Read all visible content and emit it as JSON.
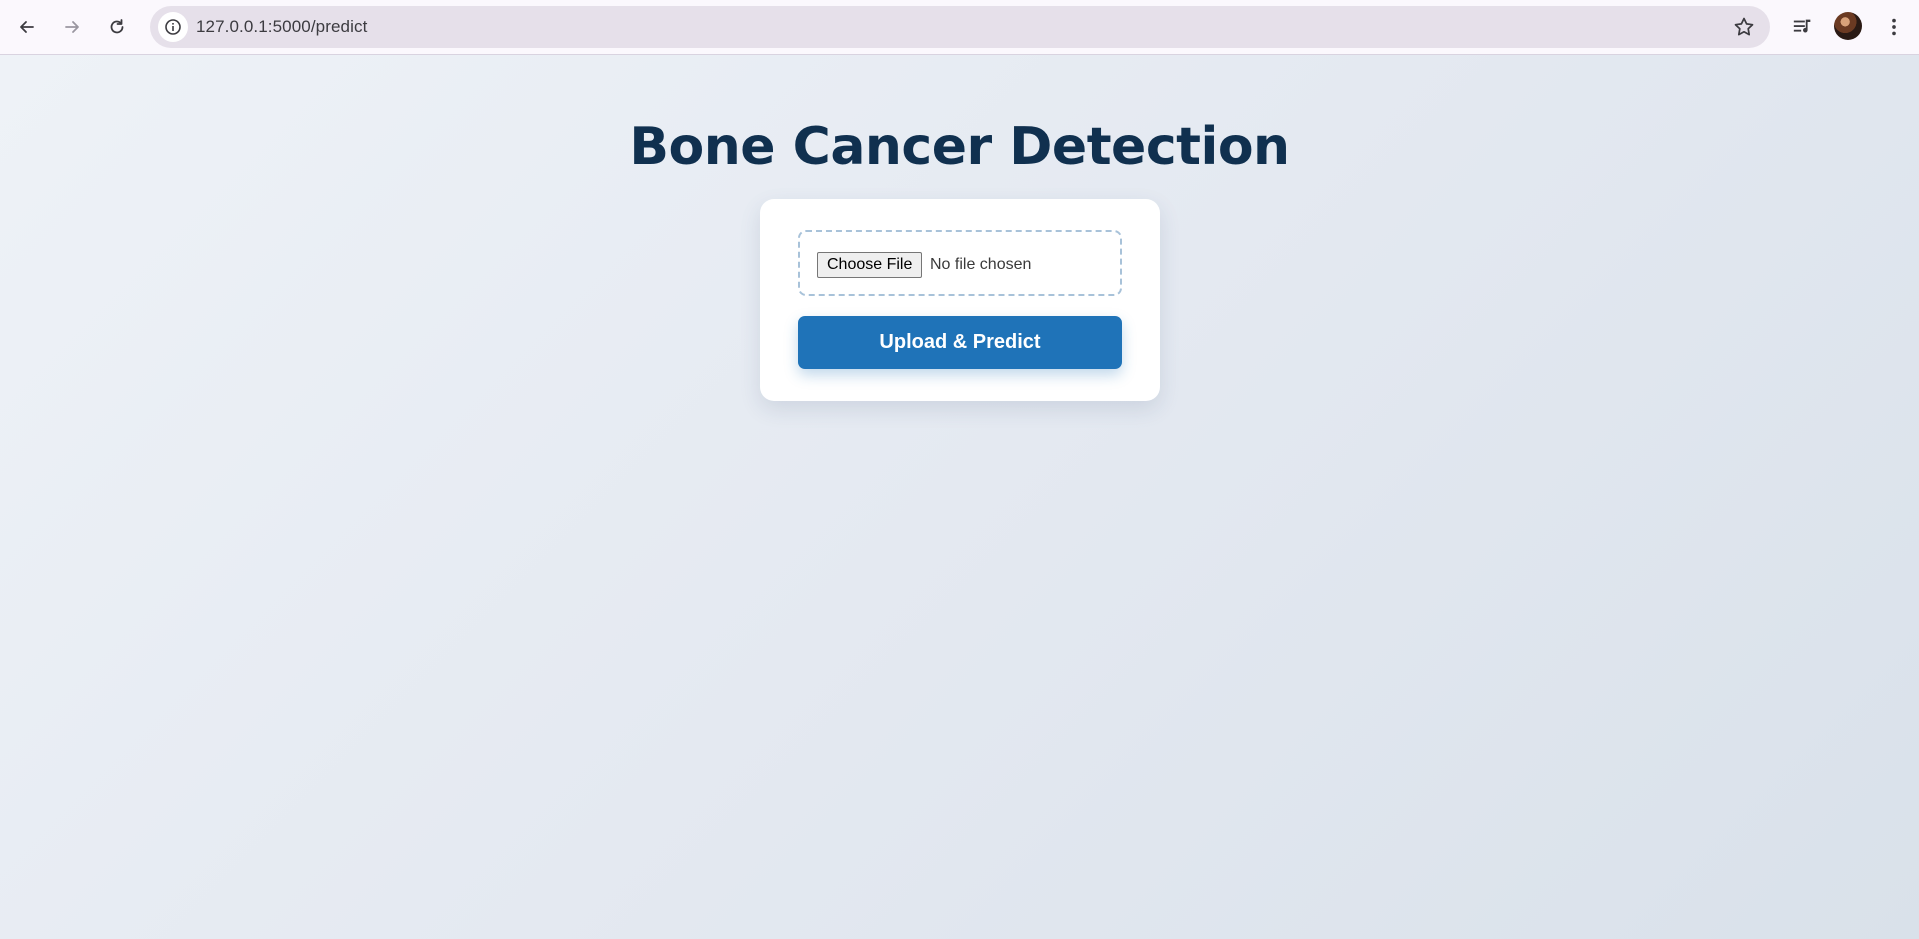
{
  "browser": {
    "url": "127.0.0.1:5000/predict",
    "icons": {
      "back": "arrow-left-icon",
      "forward": "arrow-right-icon",
      "reload": "reload-icon",
      "site_info": "info-icon",
      "bookmark": "star-icon",
      "media": "media-queue-icon",
      "profile": "avatar",
      "menu": "kebab-menu-icon"
    }
  },
  "page": {
    "title": "Bone Cancer Detection",
    "form": {
      "choose_file_label": "Choose File",
      "file_status": "No file chosen",
      "submit_label": "Upload & Predict"
    }
  },
  "colors": {
    "title": "#10304f",
    "primary_button": "#1f73b8",
    "dashed_border": "#a8c2d9"
  }
}
